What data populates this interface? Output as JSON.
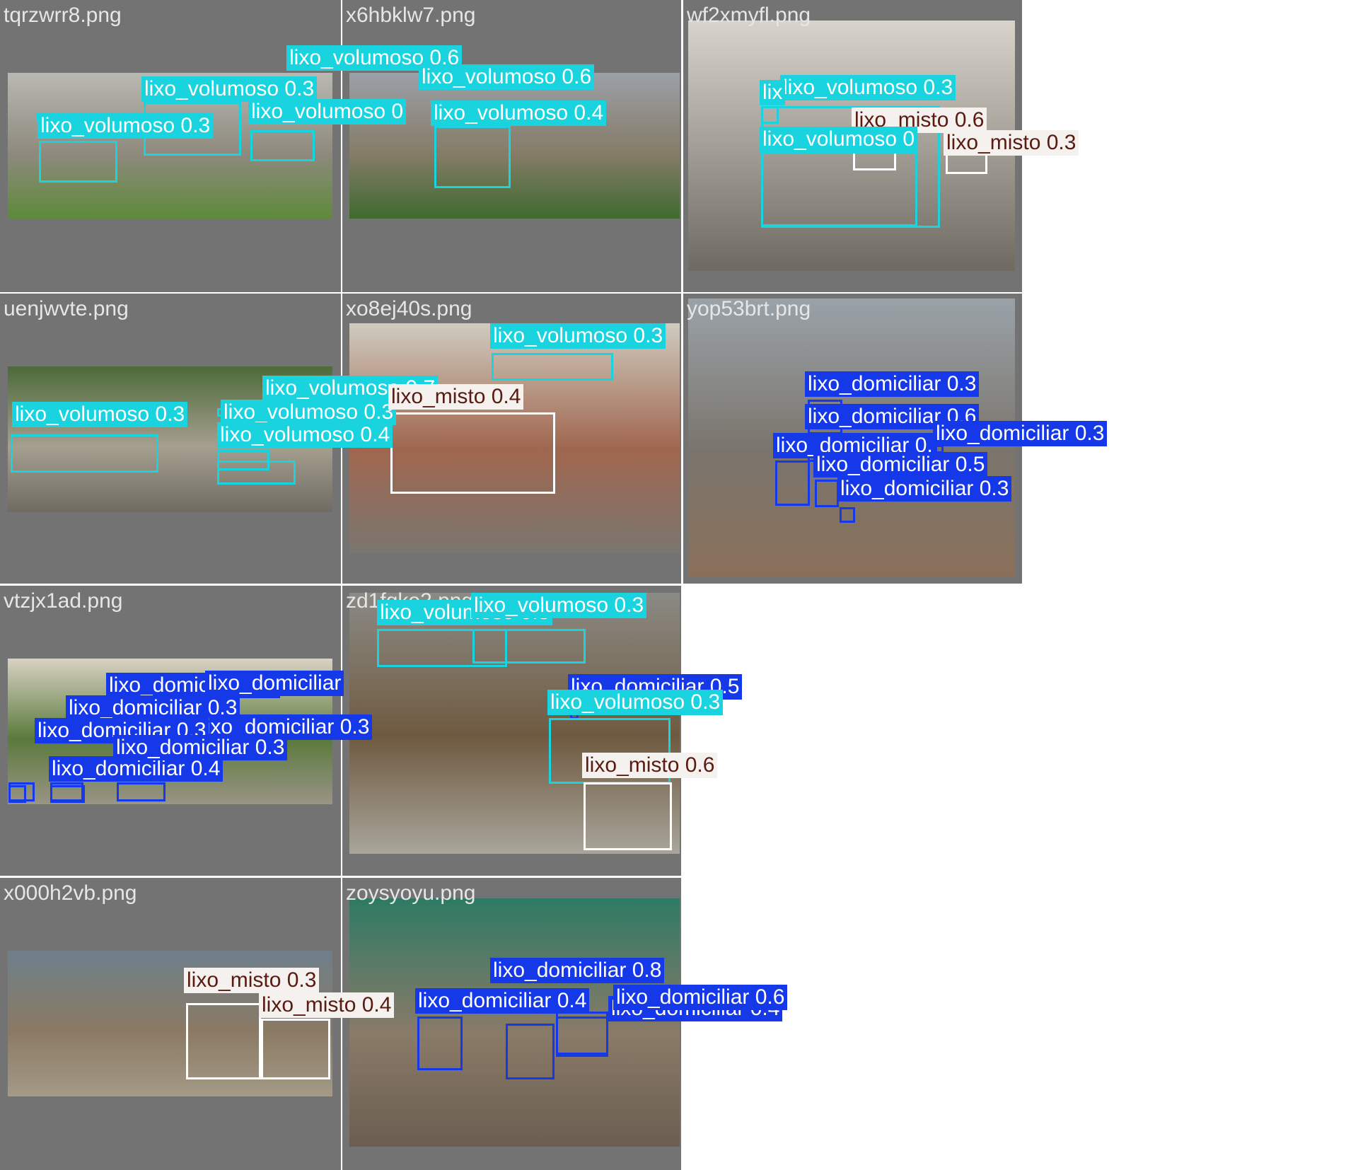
{
  "colors": {
    "tile_bg": "#737373",
    "lixo_volumoso": "#19d3df",
    "lixo_volumoso_text": "#ffffff",
    "lixo_misto": "#f4f1ef",
    "lixo_misto_text": "#5a1a10",
    "lixo_domiciliar": "#1538e8",
    "lixo_domiciliar_text": "#ffffff"
  },
  "tiles": [
    {
      "name": "tqrzwrr8.png",
      "photo_colors": [
        "#b9b9b2",
        "#8e8a7e",
        "#5e8a3a"
      ],
      "detections": [
        {
          "label": "lixo_volumoso 0.3"
        },
        {
          "label": "lixo_volumoso 0.3"
        },
        {
          "label": "lixo_volumoso 0.6"
        },
        {
          "label": "lixo_volumoso 0"
        }
      ]
    },
    {
      "name": "x6hbklw7.png",
      "photo_colors": [
        "#9ba0a8",
        "#867c68",
        "#3f6a2f"
      ],
      "detections": [
        {
          "label": "lixo_volumoso 0.6"
        },
        {
          "label": "lixo_volumoso 0.4"
        }
      ]
    },
    {
      "name": "wf2xmyfl.png",
      "photo_colors": [
        "#d8d4cb",
        "#9e9a92",
        "#6e6a62"
      ],
      "detections": [
        {
          "label": "lixo_volumoso 0.3"
        },
        {
          "label": "lixo_misto 0.6"
        },
        {
          "label": "lixo_volumoso 0"
        },
        {
          "label": "lixo_misto 0.3"
        },
        {
          "label": "lix"
        }
      ]
    },
    {
      "name": "uenjwvte.png",
      "photo_colors": [
        "#4d6a3a",
        "#a59f8f",
        "#6f6b63"
      ],
      "detections": [
        {
          "label": "lixo_volumoso 0.3"
        },
        {
          "label": "lixo_volumoso 0.3"
        },
        {
          "label": "lixo_volumoso 0.4"
        },
        {
          "label": "lixo_volumoso 0.7"
        }
      ]
    },
    {
      "name": "xo8ej40s.png",
      "photo_colors": [
        "#cfcbc0",
        "#a0664e",
        "#7a7670"
      ],
      "detections": [
        {
          "label": "lixo_volumoso 0.3"
        },
        {
          "label": "lixo_misto 0.4"
        }
      ]
    },
    {
      "name": "yop53brt.png",
      "photo_colors": [
        "#9aa2a8",
        "#7a756c",
        "#8a705a"
      ],
      "detections": [
        {
          "label": "lixo_domiciliar 0.3"
        },
        {
          "label": "lixo_domiciliar 0.6"
        },
        {
          "label": "lixo_domiciliar 0.3"
        },
        {
          "label": "lixo_domiciliar 0."
        },
        {
          "label": "lixo_domiciliar 0.5"
        },
        {
          "label": "lixo_domiciliar 0.3"
        }
      ]
    },
    {
      "name": "vtzjx1ad.png",
      "photo_colors": [
        "#d9d2c3",
        "#5a7a3c",
        "#9a9486"
      ],
      "detections": [
        {
          "label": "lixo_domiciliar 0.3"
        },
        {
          "label": "lixo_domiciliar 0.3"
        },
        {
          "label": "lixo_domiciliar 0.3"
        },
        {
          "label": "lixo_domiciliar 0.3"
        },
        {
          "label": "lixo_domiciliar 0.4"
        },
        {
          "label": "lixo_domiciliar"
        },
        {
          "label": "lixo_domiciliar 0.3"
        }
      ]
    },
    {
      "name": "zd1fqko2.png",
      "photo_colors": [
        "#8b8a85",
        "#6f5a40",
        "#a9a59b"
      ],
      "detections": [
        {
          "label": "lixo_volumoso 0.3"
        },
        {
          "label": "lixo_volumoso 0.3"
        },
        {
          "label": "lixo_domiciliar 0.5"
        },
        {
          "label": "lixo_volumoso 0.3"
        },
        {
          "label": "lixo_misto 0.6"
        }
      ]
    },
    {
      "name": "x000h2vb.png",
      "photo_colors": [
        "#6e7f8a",
        "#8a7a64",
        "#a49a86"
      ],
      "detections": [
        {
          "label": "lixo_misto 0.3"
        },
        {
          "label": "lixo_misto 0.4"
        }
      ]
    },
    {
      "name": "zoysyoyu.png",
      "photo_colors": [
        "#2e7a64",
        "#8a7a68",
        "#6a5e50"
      ],
      "detections": [
        {
          "label": "lixo_domiciliar 0.8"
        },
        {
          "label": "lixo_domiciliar 0.4"
        },
        {
          "label": "lixo_domiciliar 0.4"
        },
        {
          "label": "lixo_domiciliar 0.6"
        }
      ]
    }
  ]
}
